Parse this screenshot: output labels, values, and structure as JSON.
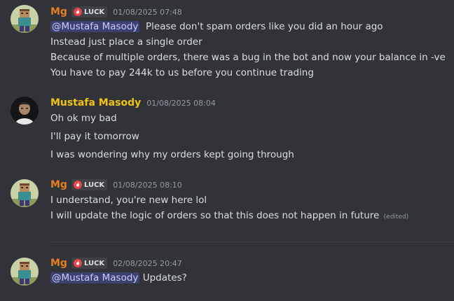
{
  "messages": [
    {
      "author": "Mg",
      "tag": "LUCK",
      "timestamp": "01/08/2025 07:48",
      "mention": "@Mustafa Masody",
      "lines": [
        "Please don't spam orders like you did an hour ago",
        "Instead just place a single order",
        "Because of multiple orders, there was a bug in the bot and now your balance in -ve",
        "You have to pay 244k to us before you continue trading"
      ]
    },
    {
      "author": "Mustafa Masody",
      "timestamp": "01/08/2025 08:04",
      "lines": [
        "Oh ok my bad",
        "I'll pay it tomorrow",
        "I was wondering why my orders kept going through"
      ]
    },
    {
      "author": "Mg",
      "tag": "LUCK",
      "timestamp": "01/08/2025 08:10",
      "lines": [
        "I understand, you're new here lol",
        "I will update the logic of orders so that this does not happen in future"
      ],
      "edited": "(edited)"
    },
    {
      "author": "Mg",
      "tag": "LUCK",
      "timestamp": "02/08/2025 20:47",
      "mention": "@Mustafa Masody",
      "lines": [
        "Updates?"
      ]
    }
  ],
  "colors": {
    "background": "#313338",
    "mg_name": "#e67e22",
    "mustafa_name": "#f1c40f",
    "mention_bg": "#3c4270"
  }
}
